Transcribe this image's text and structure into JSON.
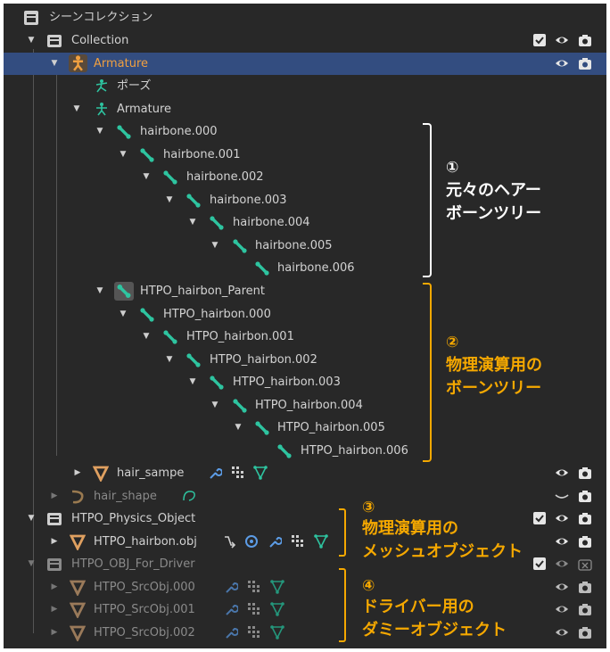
{
  "outliner": {
    "rows": [
      {
        "label": "シーンコレクション"
      },
      {
        "label": "Collection"
      },
      {
        "label": "Armature"
      },
      {
        "label": "ポーズ"
      },
      {
        "label": "Armature"
      },
      {
        "label": "hairbone.000"
      },
      {
        "label": "hairbone.001"
      },
      {
        "label": "hairbone.002"
      },
      {
        "label": "hairbone.003"
      },
      {
        "label": "hairbone.004"
      },
      {
        "label": "hairbone.005"
      },
      {
        "label": "hairbone.006"
      },
      {
        "label": "HTPO_hairbon_Parent"
      },
      {
        "label": "HTPO_hairbon.000"
      },
      {
        "label": "HTPO_hairbon.001"
      },
      {
        "label": "HTPO_hairbon.002"
      },
      {
        "label": "HTPO_hairbon.003"
      },
      {
        "label": "HTPO_hairbon.004"
      },
      {
        "label": "HTPO_hairbon.005"
      },
      {
        "label": "HTPO_hairbon.006"
      },
      {
        "label": "hair_sampe"
      },
      {
        "label": "hair_shape"
      },
      {
        "label": "HTPO_Physics_Object"
      },
      {
        "label": "HTPO_hairbon.obj"
      },
      {
        "label": "HTPO_OBJ_For_Driver"
      },
      {
        "label": "HTPO_SrcObj.000"
      },
      {
        "label": "HTPO_SrcObj.001"
      },
      {
        "label": "HTPO_SrcObj.002"
      }
    ]
  },
  "annotations": {
    "a1": {
      "num": "①",
      "line1": "元々のヘアー",
      "line2": "ボーンツリー"
    },
    "a2": {
      "num": "②",
      "line1": "物理演算用の",
      "line2": "ボーンツリー"
    },
    "a3": {
      "num": "③",
      "line1": "物理演算用の",
      "line2": "メッシュオブジェクト"
    },
    "a4": {
      "num": "④",
      "line1": "ドライバー用の",
      "line2": "ダミーオブジェクト"
    }
  },
  "colors": {
    "panel_bg": "#282828",
    "selected_row": "#334d80",
    "bone_green": "#2ec4a0",
    "mesh_orange": "#e0a060",
    "annotation_white": "#ffffff",
    "annotation_orange": "#f5a800"
  }
}
